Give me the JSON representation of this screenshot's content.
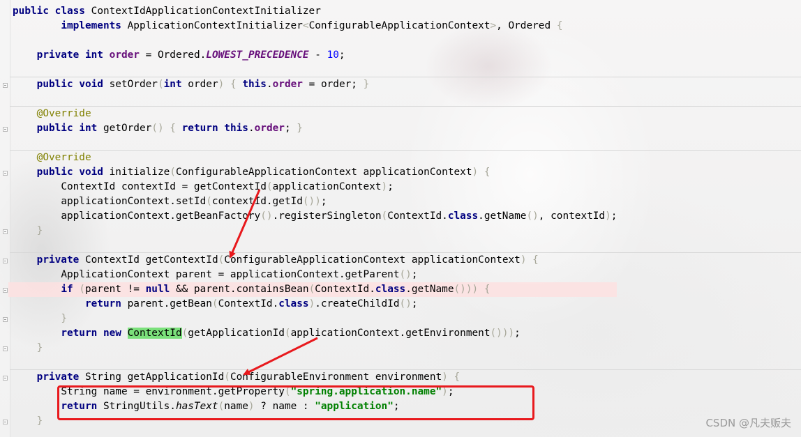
{
  "code": {
    "line1": {
      "kw1": "public",
      "kw2": "class",
      "name": "ContextIdApplicationContextInitializer"
    },
    "line2": {
      "kw": "implements",
      "type": "ApplicationContextInitializer",
      "generic": "ConfigurableApplicationContext",
      "ordered": "Ordered"
    },
    "line3": {
      "kw1": "private",
      "kw2": "int",
      "field": "order",
      "assign": " = Ordered.",
      "const": "LOWEST_PRECEDENCE",
      "minus": " - ",
      "num": "10"
    },
    "line4": {
      "kw1": "public",
      "kw2": "void",
      "method": "setOrder",
      "kw3": "int",
      "param": "order",
      "kw4": "this",
      "field": "order",
      "rhs": "order"
    },
    "line5": {
      "annotation": "@Override"
    },
    "line6": {
      "kw1": "public",
      "kw2": "int",
      "method": "getOrder",
      "kw3": "return",
      "kw4": "this",
      "field": "order"
    },
    "line7": {
      "annotation": "@Override"
    },
    "line8": {
      "kw1": "public",
      "kw2": "void",
      "method": "initialize",
      "sig": "ConfigurableApplicationContext applicationContext"
    },
    "line9": {
      "lhs": "ContextId contextId = getContextId",
      "arg": "applicationContext"
    },
    "line10": {
      "text": "applicationContext.setId",
      "arg": "contextId.getId"
    },
    "line11": {
      "text": "applicationContext.getBeanFactory",
      "mid": ".registerSingleton",
      "arg1": "ContextId.",
      "kw": "class",
      "arg2": ".getName",
      "arg3": ", contextId"
    },
    "line12": {
      "kw1": "private",
      "type": "ContextId",
      "method": "getContextId",
      "sig": "ConfigurableApplicationContext applicationContext"
    },
    "line13": {
      "text": "ApplicationContext parent = applicationContext.getParent"
    },
    "line14": {
      "kw1": "if",
      "cond1": "parent != ",
      "kw2": "null",
      "cond2": " && parent.containsBean",
      "arg1": "ContextId.",
      "kw3": "class",
      "arg2": ".getName"
    },
    "line15": {
      "kw": "return",
      "text": " parent.getBean",
      "arg1": "ContextId.",
      "kw2": "class",
      "rest": ".createChildId"
    },
    "line16": {
      "kw1": "return",
      "kw2": "new",
      "hl": "ContextId",
      "call": "getApplicationId",
      "arg": "applicationContext.getEnvironment"
    },
    "line17": {
      "kw1": "private",
      "type": "String",
      "method": "getApplicationId",
      "sig": "ConfigurableEnvironment environment"
    },
    "line18": {
      "lhs": "String name = environment.getProperty",
      "str": "\"spring.application.name\""
    },
    "line19": {
      "kw": "return",
      "text": " StringUtils.",
      "mi": "hasText",
      "arg": "name",
      "tern": " ? name : ",
      "str": "\"application\""
    }
  },
  "watermark": "CSDN @凡夫贩夫",
  "colors": {
    "keyword": "#000080",
    "field": "#660e7a",
    "string": "#008000",
    "number": "#0000ff",
    "annotation": "#808000",
    "highlight": "#7be07b",
    "arrow": "#e8191d"
  }
}
